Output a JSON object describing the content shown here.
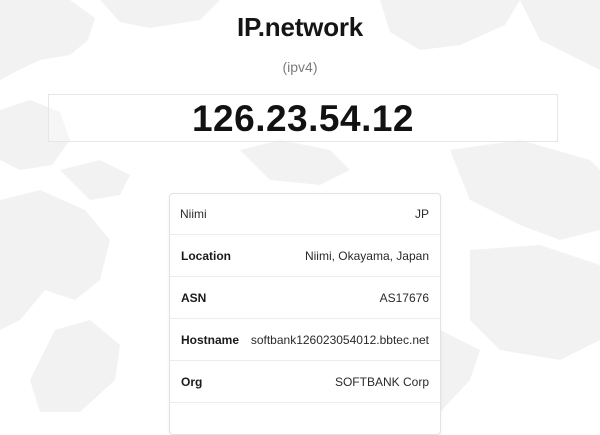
{
  "header": {
    "site_title": "IP.network",
    "ip_version": "(ipv4)"
  },
  "ip": {
    "address": "126.23.54.12"
  },
  "info": {
    "city": "Niimi",
    "country_code": "JP",
    "rows": [
      {
        "label": "Location",
        "value": "Niimi, Okayama, Japan"
      },
      {
        "label": "ASN",
        "value": "AS17676"
      },
      {
        "label": "Hostname",
        "value": "softbank126023054012.bbtec.net"
      },
      {
        "label": "Org",
        "value": "SOFTBANK Corp"
      }
    ]
  },
  "colors": {
    "map_fill": "#f1f1f1",
    "title_text": "#151515",
    "muted_text": "#7b7b7b"
  }
}
